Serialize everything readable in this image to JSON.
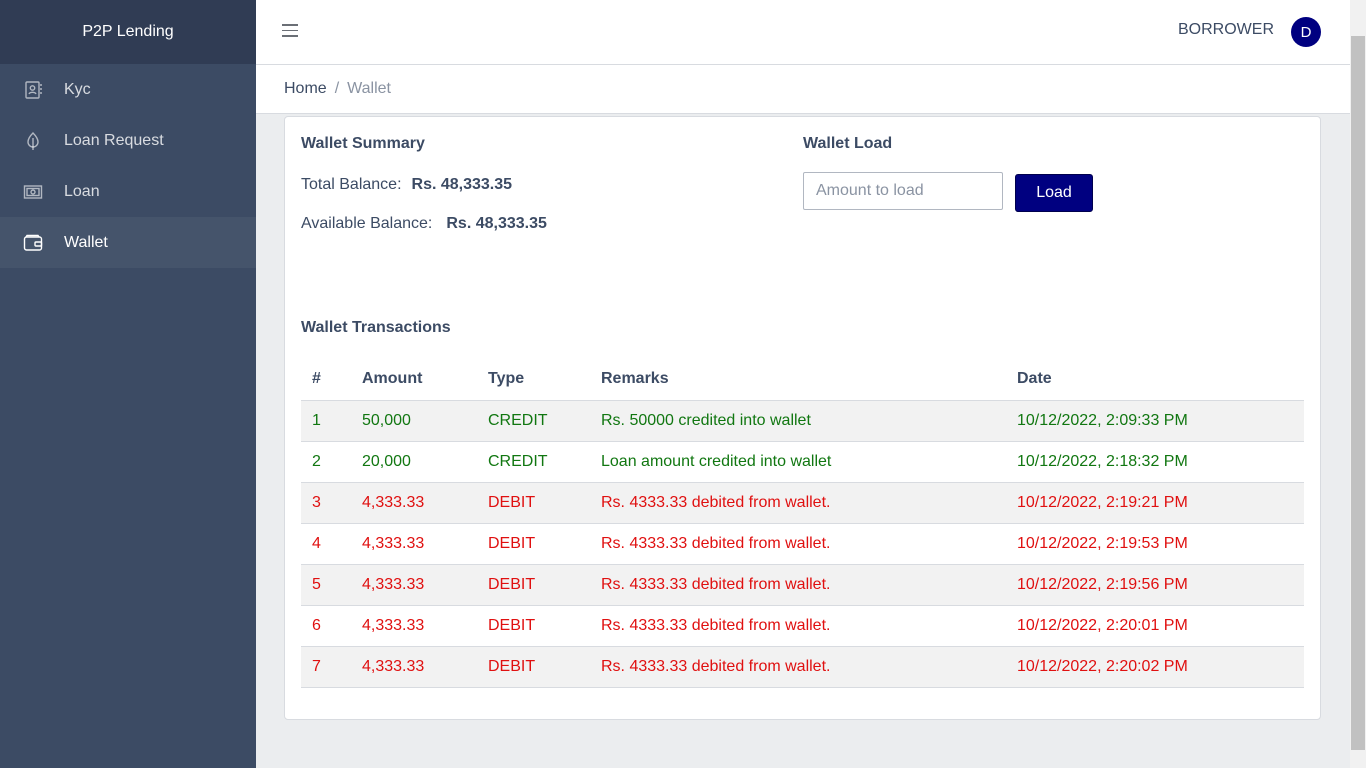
{
  "app": {
    "brand": "P2P Lending"
  },
  "sidebar": {
    "items": [
      {
        "label": "Kyc",
        "icon": "kyc-icon"
      },
      {
        "label": "Loan Request",
        "icon": "leaf-icon"
      },
      {
        "label": "Loan",
        "icon": "money-icon"
      },
      {
        "label": "Wallet",
        "icon": "wallet-icon",
        "active": true
      }
    ]
  },
  "header": {
    "role": "BORROWER",
    "avatar_letter": "D"
  },
  "breadcrumb": {
    "home": "Home",
    "separator": "/",
    "current": "Wallet"
  },
  "summary": {
    "title": "Wallet Summary",
    "total_label": "Total Balance:",
    "total_value": "Rs. 48,333.35",
    "available_label": "Available Balance:",
    "available_value": "Rs. 48,333.35"
  },
  "load": {
    "title": "Wallet Load",
    "placeholder": "Amount to load",
    "button": "Load"
  },
  "transactions": {
    "title": "Wallet Transactions",
    "columns": [
      "#",
      "Amount",
      "Type",
      "Remarks",
      "Date"
    ],
    "rows": [
      {
        "n": "1",
        "amount": "50,000",
        "type": "CREDIT",
        "remarks": "Rs. 50000 credited into wallet",
        "date": "10/12/2022, 2:09:33 PM"
      },
      {
        "n": "2",
        "amount": "20,000",
        "type": "CREDIT",
        "remarks": "Loan amount credited into wallet",
        "date": "10/12/2022, 2:18:32 PM"
      },
      {
        "n": "3",
        "amount": "4,333.33",
        "type": "DEBIT",
        "remarks": "Rs. 4333.33 debited from wallet.",
        "date": "10/12/2022, 2:19:21 PM"
      },
      {
        "n": "4",
        "amount": "4,333.33",
        "type": "DEBIT",
        "remarks": "Rs. 4333.33 debited from wallet.",
        "date": "10/12/2022, 2:19:53 PM"
      },
      {
        "n": "5",
        "amount": "4,333.33",
        "type": "DEBIT",
        "remarks": "Rs. 4333.33 debited from wallet.",
        "date": "10/12/2022, 2:19:56 PM"
      },
      {
        "n": "6",
        "amount": "4,333.33",
        "type": "DEBIT",
        "remarks": "Rs. 4333.33 debited from wallet.",
        "date": "10/12/2022, 2:20:01 PM"
      },
      {
        "n": "7",
        "amount": "4,333.33",
        "type": "DEBIT",
        "remarks": "Rs. 4333.33 debited from wallet.",
        "date": "10/12/2022, 2:20:02 PM"
      }
    ]
  },
  "colors": {
    "sidebar": "#3c4b64",
    "brand_bar": "#303c54",
    "accent": "#000080",
    "credit": "#117711",
    "debit": "#e01010"
  }
}
